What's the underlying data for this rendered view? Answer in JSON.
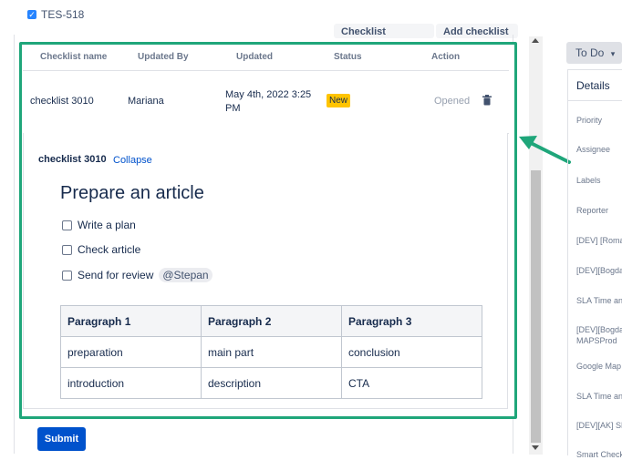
{
  "issue": {
    "key": "TES-518"
  },
  "top_buttons": {
    "manager": "Checklist Manager",
    "add": "Add checklist"
  },
  "table_header": {
    "name": "Checklist name",
    "updated_by": "Updated By",
    "updated": "Updated",
    "status": "Status",
    "action": "Action"
  },
  "row": {
    "name": "checklist 3010",
    "updated_by": "Mariana",
    "updated_line1": "May 4th, 2022 3:25",
    "updated_line2": "PM",
    "status": "New",
    "action": "Opened",
    "delete_icon": "trash-icon"
  },
  "expanded": {
    "name": "checklist 3010",
    "collapse": "Collapse",
    "title": "Prepare an article",
    "items": [
      {
        "label": "Write a plan",
        "checked": false
      },
      {
        "label": "Check article",
        "checked": false
      },
      {
        "label": "Send for review",
        "checked": false,
        "mention": "@Stepan"
      }
    ],
    "table": {
      "headers": [
        "Paragraph 1",
        "Paragraph 2",
        "Paragraph 3"
      ],
      "rows": [
        [
          "preparation",
          "main part",
          "conclusion"
        ],
        [
          "introduction",
          "description",
          "CTA"
        ]
      ]
    }
  },
  "submit": "Submit",
  "sidebar": {
    "status_button": "To Do",
    "details_title": "Details",
    "fields": [
      "Priority",
      "Assignee",
      "Labels",
      "Reporter",
      "[DEV] [Roma",
      "[DEV][Bogda",
      "SLA Time an",
      "[DEV][Bogda",
      "MAPSProd",
      "Google Map",
      "SLA Time an",
      "[DEV][AK] SL",
      "Smart Check"
    ]
  },
  "colors": {
    "highlight": "#1fa67a",
    "primary": "#0052cc",
    "status_new": "#ffc400"
  }
}
